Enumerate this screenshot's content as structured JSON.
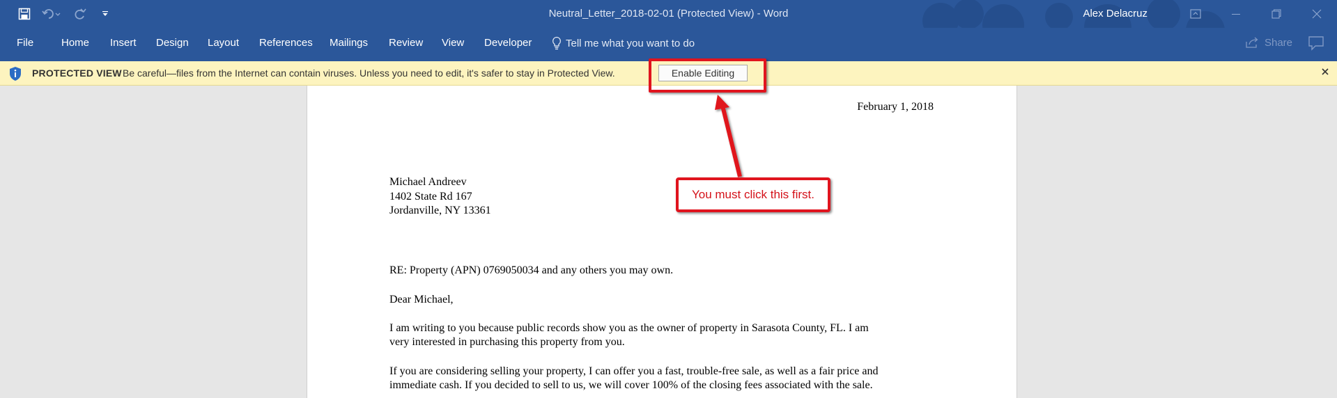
{
  "titlebar": {
    "document_title": "Neutral_Letter_2018-02-01 (Protected View)  -  Word",
    "user_name": "Alex Delacruz"
  },
  "ribbon": {
    "tabs": [
      "File",
      "Home",
      "Insert",
      "Design",
      "Layout",
      "References",
      "Mailings",
      "Review",
      "View",
      "Developer"
    ],
    "tell_me": "Tell me what you want to do",
    "share": "Share"
  },
  "protected_view": {
    "title": "PROTECTED VIEW",
    "message": "Be careful—files from the Internet can contain viruses. Unless you need to edit, it's safer to stay in Protected View.",
    "button": "Enable Editing"
  },
  "letter": {
    "date": "February 1, 2018",
    "recipient_name": "Michael Andreev",
    "recipient_street": "1402 State Rd 167",
    "recipient_city": "Jordanville, NY 13361",
    "re_line": "RE: Property (APN) 0769050034 and any others you may own.",
    "salutation": "Dear Michael,",
    "para1_line1": "I am writing to you because public records show you as the owner of property in Sarasota County, FL. I am",
    "para1_line2": "very interested in purchasing this property from you.",
    "para2_line1": "If you are considering selling your property, I can offer you a fast, trouble-free sale, as well as a fair price and",
    "para2_line2": "immediate cash. If you decided to sell to us, we will cover 100% of the closing fees associated with the sale."
  },
  "annotation": {
    "callout_text": "You must click this first.",
    "color": "#e0141e"
  },
  "colors": {
    "word_blue": "#2b579a",
    "protected_bar": "#fdf4bf"
  },
  "icons": [
    "save-icon",
    "undo-icon",
    "redo-icon",
    "customize-qat-icon",
    "ribbon-display-options-icon",
    "minimize-icon",
    "restore-icon",
    "close-icon",
    "lightbulb-icon",
    "share-icon",
    "comment-icon",
    "shield-info-icon",
    "close-bar-icon"
  ]
}
